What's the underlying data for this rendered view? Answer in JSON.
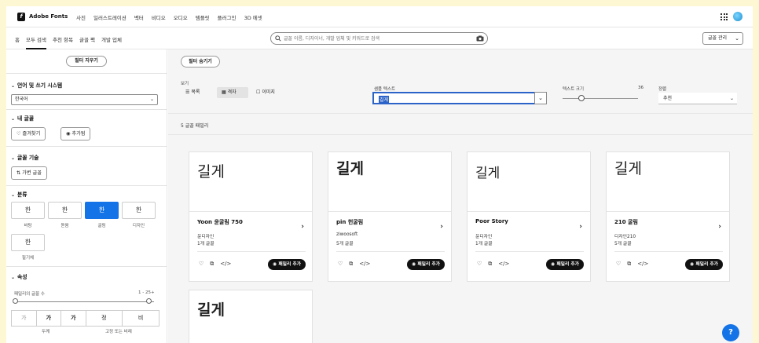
{
  "app": {
    "logo_text": "Adobe Fonts",
    "logo_glyph": "f"
  },
  "topnav": [
    "사진",
    "일러스트레이션",
    "벡터",
    "비디오",
    "오디오",
    "템플릿",
    "플러그인",
    "3D 에셋"
  ],
  "subnav": {
    "items": [
      "홈",
      "모두 검색",
      "추천 항목",
      "글꼴 팩",
      "개발 업체"
    ],
    "active_index": 1
  },
  "search": {
    "placeholder": "글꼴 이름, 디자이너, 개발 업체 및 키워드로 검색"
  },
  "manage_label": "글꼴 관리",
  "sidebar": {
    "clear_filters": "필터 지우기",
    "lang_title": "언어 및 쓰기 시스템",
    "lang_value": "한국어",
    "my_fonts_title": "내 글꼴",
    "favorites": "즐겨찾기",
    "added": "추가됨",
    "tech_title": "글꼴 기술",
    "variable": "가변 글꼴",
    "class_title": "분류",
    "classes": [
      {
        "glyph": "한",
        "label": "바탕",
        "active": false
      },
      {
        "glyph": "한",
        "label": "돋움",
        "active": false
      },
      {
        "glyph": "한",
        "label": "굴림",
        "active": true
      },
      {
        "glyph": "한",
        "label": "디자인",
        "active": false
      },
      {
        "glyph": "한",
        "label": "필기체",
        "active": false
      }
    ],
    "props_title": "속성",
    "family_count_label": "패밀리의 글꼴 수",
    "family_count_range": "1 - 25+",
    "weight_glyphs": [
      "가",
      "가",
      "가"
    ],
    "width_glyphs": [
      "정",
      "비"
    ],
    "weight_label": "두께",
    "width_label": "고정 또는 비례"
  },
  "main": {
    "hide_filters": "필터 숨기기",
    "view_label": "보기",
    "view_list": "목록",
    "view_grid": "격자",
    "view_image": "이미지",
    "sample_label": "샘플 텍스트",
    "sample_value": "길게",
    "size_label": "텍스트 크기",
    "size_value": "36",
    "sort_label": "정렬",
    "sort_value": "추천",
    "result_count": "5 글꼴 패밀리"
  },
  "cards": [
    {
      "preview": "길게",
      "name": "Yoon 윤굴림 750",
      "foundry": "윤디자인",
      "count": "1개 글꼴",
      "add": "패밀리 추가"
    },
    {
      "preview": "길게",
      "name": "pin 헌굴림",
      "foundry": "ziwoosoft",
      "count": "5개 글꼴",
      "add": "패밀리 추가"
    },
    {
      "preview": "길게",
      "name": "Poor Story",
      "foundry": "윤디자인",
      "count": "1개 글꼴",
      "add": "패밀리 추가"
    },
    {
      "preview": "길게",
      "name": "210 굴림",
      "foundry": "디자인210",
      "count": "5개 글꼴",
      "add": "패밀리 추가"
    },
    {
      "preview": "길게"
    }
  ],
  "help_label": "?"
}
